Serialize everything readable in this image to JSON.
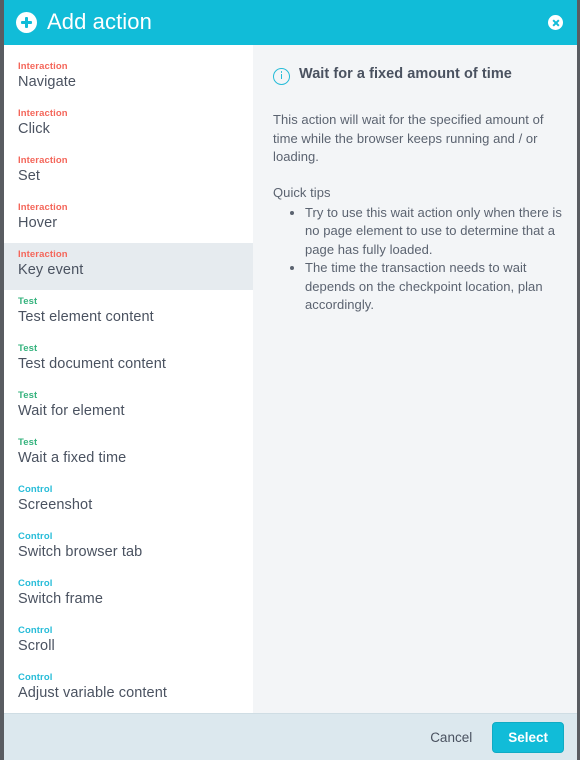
{
  "header": {
    "title": "Add action",
    "add_icon": "plus-circle-icon",
    "close_icon": "close-circle-icon",
    "accent_color": "#11bcd8"
  },
  "action_list": {
    "selected_index": 4,
    "items": [
      {
        "category": "Interaction",
        "name": "Navigate",
        "category_color": "#f4665a"
      },
      {
        "category": "Interaction",
        "name": "Click",
        "category_color": "#f4665a"
      },
      {
        "category": "Interaction",
        "name": "Set",
        "category_color": "#f4665a"
      },
      {
        "category": "Interaction",
        "name": "Hover",
        "category_color": "#f4665a"
      },
      {
        "category": "Interaction",
        "name": "Key event",
        "category_color": "#f4665a"
      },
      {
        "category": "Test",
        "name": "Test element content",
        "category_color": "#36b37e"
      },
      {
        "category": "Test",
        "name": "Test document content",
        "category_color": "#36b37e"
      },
      {
        "category": "Test",
        "name": "Wait for element",
        "category_color": "#36b37e"
      },
      {
        "category": "Test",
        "name": "Wait a fixed time",
        "category_color": "#36b37e"
      },
      {
        "category": "Control",
        "name": "Screenshot",
        "category_color": "#26bcd8"
      },
      {
        "category": "Control",
        "name": "Switch browser tab",
        "category_color": "#26bcd8"
      },
      {
        "category": "Control",
        "name": "Switch frame",
        "category_color": "#26bcd8"
      },
      {
        "category": "Control",
        "name": "Scroll",
        "category_color": "#26bcd8"
      },
      {
        "category": "Control",
        "name": "Adjust variable content",
        "category_color": "#26bcd8"
      }
    ]
  },
  "info_panel": {
    "icon": "info-circle-icon",
    "title": "Wait for a fixed amount of time",
    "description": "This action will wait for the specified amount of time while the browser keeps running and / or loading.",
    "tips_title": "Quick tips",
    "tips": [
      "Try to use this wait action only when there is no page element to use to determine that a page has fully loaded.",
      "The time the transaction needs to wait depends on the checkpoint location, plan accordingly."
    ]
  },
  "footer": {
    "cancel_label": "Cancel",
    "select_label": "Select",
    "select_color": "#11bcd8"
  }
}
